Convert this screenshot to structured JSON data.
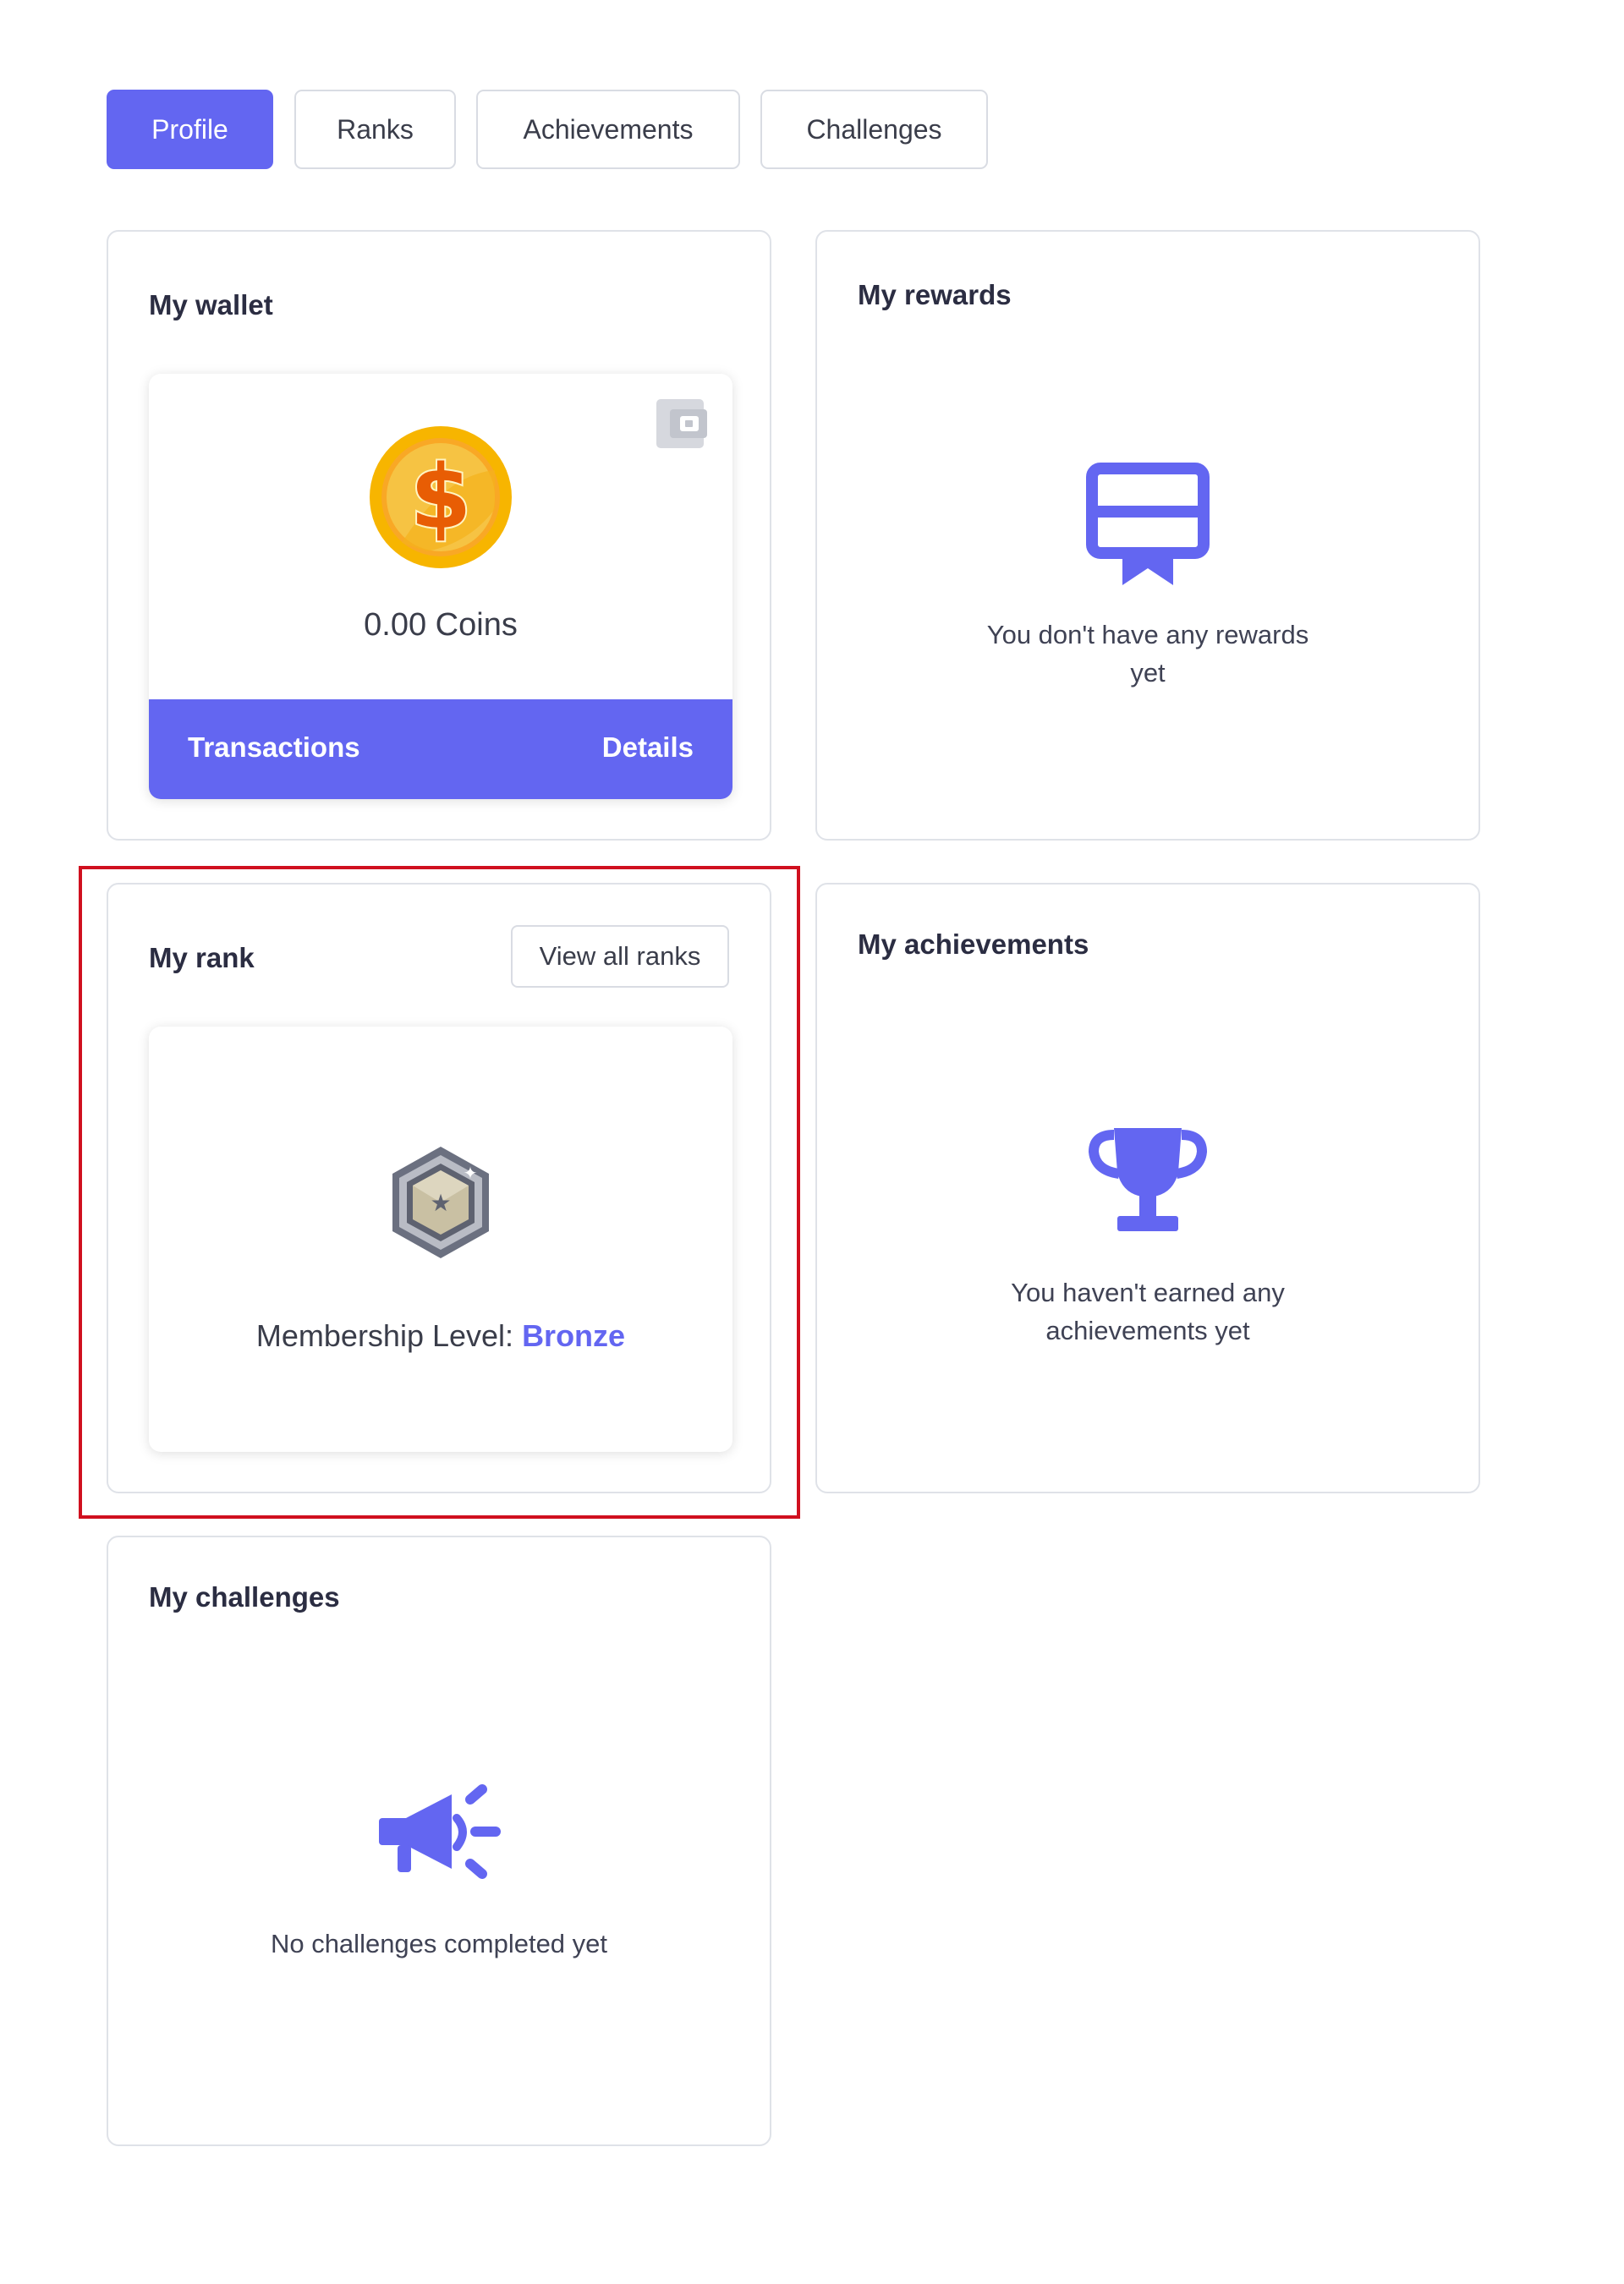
{
  "tabs": [
    {
      "label": "Profile",
      "active": true
    },
    {
      "label": "Ranks",
      "active": false
    },
    {
      "label": "Achievements",
      "active": false
    },
    {
      "label": "Challenges",
      "active": false
    }
  ],
  "wallet": {
    "title": "My wallet",
    "balance": "0.00 Coins",
    "transactions_label": "Transactions",
    "details_label": "Details",
    "icons": [
      "coin-icon",
      "wallet-icon"
    ]
  },
  "rewards": {
    "title": "My rewards",
    "empty_text": "You don't have any rewards yet",
    "icon": "voucher-icon"
  },
  "rank": {
    "title": "My rank",
    "view_all_label": "View all ranks",
    "membership_label": "Membership Level:",
    "membership_level": "Bronze",
    "icon": "rank-badge-icon"
  },
  "achievements": {
    "title": "My achievements",
    "empty_text": "You haven't earned any achievements yet",
    "icon": "trophy-icon"
  },
  "challenges": {
    "title": "My challenges",
    "empty_text": "No challenges completed yet",
    "icon": "megaphone-icon"
  },
  "colors": {
    "accent": "#6366f1",
    "border": "#dfe2e8",
    "highlight": "#d0101f",
    "coin": "#f5b301"
  }
}
